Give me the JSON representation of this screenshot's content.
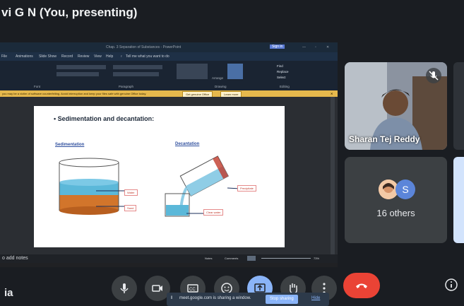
{
  "presenter": {
    "name": "vi G N (You, presenting)"
  },
  "ppt": {
    "title_text": "Chap. 3 Separation of Substances - PowerPoint",
    "account_btn": "Sign in",
    "tabs": [
      "File",
      "Animations",
      "Slide Show",
      "Record",
      "Review",
      "View",
      "Help"
    ],
    "tell_me": "Tell me what you want to do",
    "groups": {
      "font": "Font",
      "paragraph": "Paragraph",
      "drawing": "Drawing",
      "editing": "Editing"
    },
    "arrange": "Arrange",
    "editing_items": [
      "Find",
      "Replace",
      "Select"
    ],
    "infobar_text": "you may be a victim of software counterfeiting. Avoid interruption and keep your files safe with genuine Office today.",
    "infobar_btn1": "Get genuine Office",
    "infobar_btn2": "Learn more",
    "notes_text": "o add notes",
    "status_notes": "Notes",
    "status_comments": "Comments",
    "zoom": "73%"
  },
  "slide": {
    "title": "• Sedimentation and decantation:",
    "left_heading": "Sedimentation",
    "right_heading": "Decantation",
    "labels": {
      "water": "Water",
      "sand": "Sand",
      "precipitate": "Precipitate",
      "clear_water": "Clear water"
    }
  },
  "participants": {
    "main_name": "Sharan Tej Reddy",
    "others_label": "16 others",
    "avatar_letter": "S"
  },
  "controls": {
    "bottom_left_text": "ia",
    "share_notice": "meet.google.com is sharing a window.",
    "stop_sharing": "Stop sharing",
    "hide": "Hide"
  },
  "colors": {
    "end_call": "#ea4335",
    "accent": "#8ab4f8",
    "water": "#5bb8d9",
    "sand": "#d2752b"
  }
}
